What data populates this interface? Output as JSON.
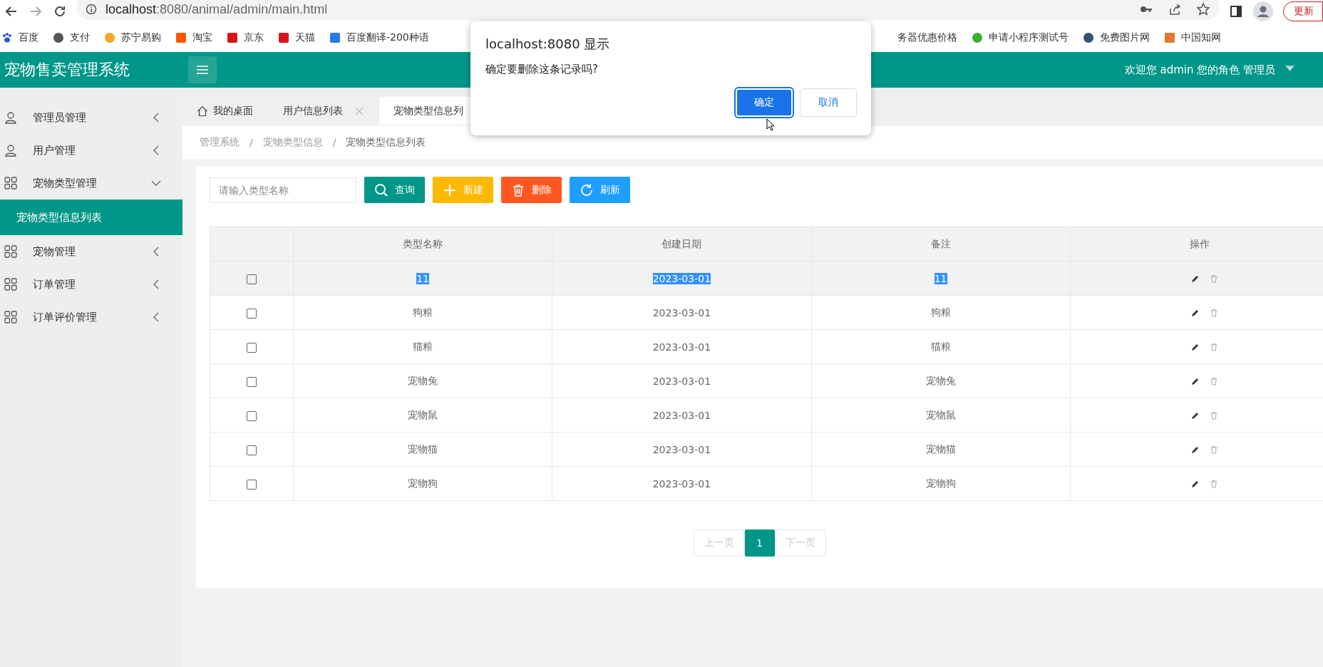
{
  "browser": {
    "url_host": "localhost",
    "url_rest": ":8080/animal/admin/main.html",
    "update_button": "更新"
  },
  "bookmarks_left": [
    {
      "label": "百度"
    },
    {
      "label": "支付"
    },
    {
      "label": "苏宁易购"
    },
    {
      "label": "淘宝"
    },
    {
      "label": "京东"
    },
    {
      "label": "天猫"
    },
    {
      "label": "百度翻译-200种语"
    }
  ],
  "bookmarks_right": [
    {
      "label": "务器优惠价格"
    },
    {
      "label": "申请小程序测试号"
    },
    {
      "label": "免费图片网"
    },
    {
      "label": "中国知网"
    }
  ],
  "header": {
    "title": "宠物售卖管理系统",
    "user": "欢迎您 admin 您的角色 管理员"
  },
  "sidebar": {
    "items": [
      {
        "label": "管理员管理",
        "kind": "user",
        "expanded": false
      },
      {
        "label": "用户管理",
        "kind": "user",
        "expanded": false
      },
      {
        "label": "宠物类型管理",
        "kind": "grid",
        "expanded": true,
        "children": [
          {
            "label": "宠物类型信息列表",
            "selected": true
          }
        ]
      },
      {
        "label": "宠物管理",
        "kind": "grid",
        "expanded": false
      },
      {
        "label": "订单管理",
        "kind": "grid",
        "expanded": false
      },
      {
        "label": "订单评价管理",
        "kind": "grid",
        "expanded": false
      }
    ]
  },
  "tabs": [
    {
      "label": "我的桌面",
      "kind": "home",
      "closable": false,
      "selected": false
    },
    {
      "label": "用户信息列表",
      "kind": "plain",
      "closable": true,
      "selected": false
    },
    {
      "label": "宠物类型信息列",
      "kind": "plain",
      "closable": false,
      "selected": true
    }
  ],
  "breadcrumb": {
    "separator": "/",
    "items": [
      "管理系统",
      "宠物类型信息",
      "宠物类型信息列表"
    ]
  },
  "search": {
    "placeholder": "请输入类型名称"
  },
  "toolbar": [
    {
      "label": "查询",
      "kind": "search"
    },
    {
      "label": "新建",
      "kind": "add"
    },
    {
      "label": "删除",
      "kind": "delete"
    },
    {
      "label": "刷新",
      "kind": "refresh"
    }
  ],
  "table": {
    "columns": [
      "类型名称",
      "创建日期",
      "备注",
      "操作"
    ],
    "rows": [
      {
        "name": "11",
        "date": "2023-03-01",
        "note": "11",
        "checked": false,
        "highlighted": true
      },
      {
        "name": "狗粮",
        "date": "2023-03-01",
        "note": "狗粮",
        "checked": false,
        "highlighted": false
      },
      {
        "name": "猫粮",
        "date": "2023-03-01",
        "note": "猫粮",
        "checked": false,
        "highlighted": false
      },
      {
        "name": "宠物兔",
        "date": "2023-03-01",
        "note": "宠物兔",
        "checked": false,
        "highlighted": false
      },
      {
        "name": "宠物鼠",
        "date": "2023-03-01",
        "note": "宠物鼠",
        "checked": false,
        "highlighted": false
      },
      {
        "name": "宠物猫",
        "date": "2023-03-01",
        "note": "宠物猫",
        "checked": false,
        "highlighted": false
      },
      {
        "name": "宠物狗",
        "date": "2023-03-01",
        "note": "宠物狗",
        "checked": false,
        "highlighted": false
      }
    ]
  },
  "pagination": [
    {
      "label": "上一页",
      "kind": "prev",
      "selected": false
    },
    {
      "label": "1",
      "kind": "page",
      "selected": true
    },
    {
      "label": "下一页",
      "kind": "next",
      "selected": false
    }
  ],
  "dialog": {
    "title": "localhost:8080 显示",
    "message": "确定要删除这条记录吗?",
    "buttons": [
      {
        "label": "确定",
        "kind": "primary"
      },
      {
        "label": "取消",
        "kind": "secondary"
      }
    ]
  }
}
